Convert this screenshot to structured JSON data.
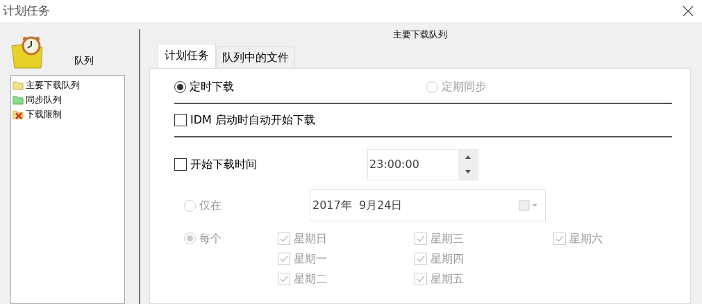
{
  "window": {
    "title": "计划任务"
  },
  "sidebar": {
    "heading": "队列",
    "items": [
      {
        "label": "主要下载队列",
        "kind": "folder",
        "selected": false
      },
      {
        "label": "同步队列",
        "kind": "sync",
        "selected": false
      },
      {
        "label": "下载限制",
        "kind": "limit",
        "selected": false
      }
    ]
  },
  "queue_title": "主要下载队列",
  "tabs": [
    {
      "label": "计划任务",
      "selected": true
    },
    {
      "label": "队列中的文件",
      "selected": false
    }
  ],
  "modes": [
    {
      "label": "定时下载",
      "selected": true,
      "disabled": false
    },
    {
      "label": "定期同步",
      "selected": false,
      "disabled": true
    }
  ],
  "autostart": {
    "label": "IDM 启动时自动开始下载",
    "checked": false
  },
  "start_time": {
    "label": "开始下载时间",
    "checked": false,
    "value": "23:00:00"
  },
  "once": {
    "label": "仅在",
    "selected": false,
    "disabled": true,
    "date": "2017年  9月24日"
  },
  "every": {
    "label": "每个",
    "selected": true,
    "disabled": true
  },
  "days": [
    {
      "label": "星期日",
      "checked": true,
      "disabled": true
    },
    {
      "label": "星期一",
      "checked": true,
      "disabled": true
    },
    {
      "label": "星期二",
      "checked": true,
      "disabled": true
    },
    {
      "label": "星期三",
      "checked": true,
      "disabled": true
    },
    {
      "label": "星期四",
      "checked": true,
      "disabled": true
    },
    {
      "label": "星期五",
      "checked": true,
      "disabled": true
    },
    {
      "label": "星期六",
      "checked": true,
      "disabled": true
    }
  ]
}
